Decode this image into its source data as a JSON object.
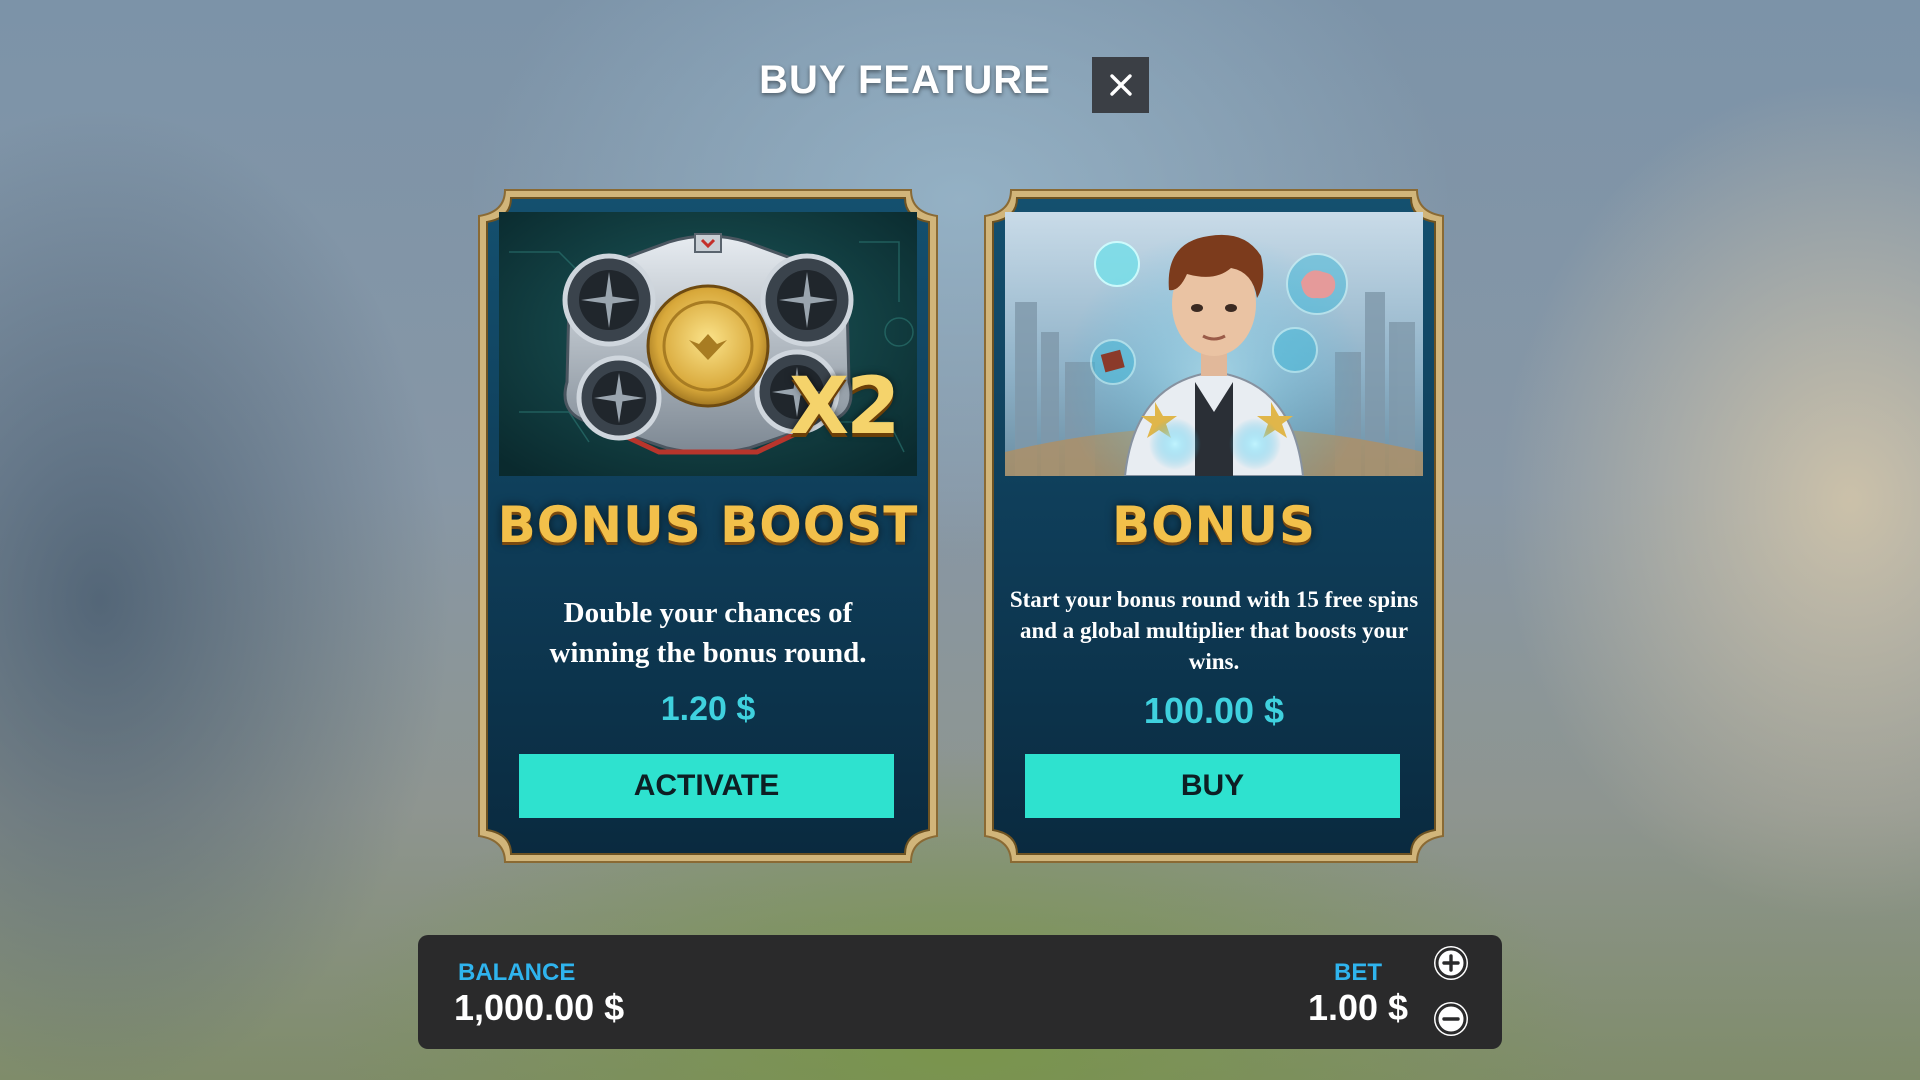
{
  "header": {
    "title": "BUY FEATURE",
    "close_icon": "close-icon"
  },
  "cards": [
    {
      "image": "drone-x2-art",
      "image_badge": "X2",
      "title": "BONUS BOOST",
      "description": "Double your chances of winning the bonus round.",
      "price": "1.20 $",
      "button": "ACTIVATE"
    },
    {
      "image": "space-cadet-art",
      "title": "BONUS",
      "description": "Start your bonus round with 15 free spins and a global multiplier that boosts your wins.",
      "price": "100.00 $",
      "button": "BUY"
    }
  ],
  "footer": {
    "balance_label": "BALANCE",
    "balance_value": "1,000.00 $",
    "bet_label": "BET",
    "bet_value": "1.00 $",
    "increase_icon": "plus-icon",
    "decrease_icon": "minus-icon"
  },
  "colors": {
    "accent_button": "#2ee2cf",
    "price": "#3fd1de",
    "label_blue": "#2fb4ee",
    "card_gold": "#c9a86a",
    "title_gold": "#f2c04a",
    "card_navy": "#0e3a55"
  }
}
